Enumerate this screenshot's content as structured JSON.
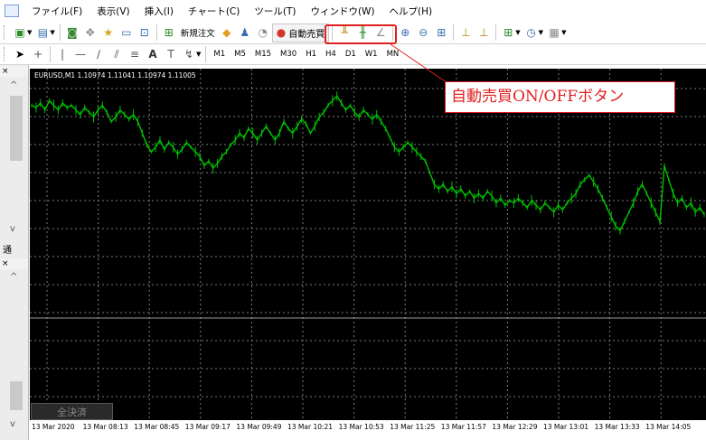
{
  "menu": [
    "ファイル(F)",
    "表示(V)",
    "挿入(I)",
    "チャート(C)",
    "ツール(T)",
    "ウィンドウ(W)",
    "ヘルプ(H)"
  ],
  "toolbar": {
    "new_order_label": "新規注文",
    "auto_trading_label": "自動売買"
  },
  "timeframes": [
    "M1",
    "M5",
    "M15",
    "M30",
    "H1",
    "H4",
    "D1",
    "W1",
    "MN"
  ],
  "left_panel": {
    "close_glyph": "×",
    "tab_label": "通"
  },
  "chart": {
    "title": "EURUSD,M1  1.10974 1.11041 1.10974 1.11005",
    "line_color": "#00c000",
    "background": "#000000",
    "grid_color": "#7a7a7a",
    "closed_tab_label": "全決済"
  },
  "chart_data": {
    "type": "line",
    "title": "EURUSD,M1  1.10974 1.11041 1.10974 1.11005",
    "xlabel": "",
    "ylabel": "",
    "x_ticks": [
      "13 Mar 2020",
      "13 Mar 08:13",
      "13 Mar 08:45",
      "13 Mar 09:17",
      "13 Mar 09:49",
      "13 Mar 10:21",
      "13 Mar 10:53",
      "13 Mar 11:25",
      "13 Mar 11:57",
      "13 Mar 12:29",
      "13 Mar 13:01",
      "13 Mar 13:33",
      "13 Mar 14:05"
    ],
    "grid": true,
    "series": [
      {
        "values": [
          0.62,
          0.61,
          0.63,
          0.6,
          0.64,
          0.62,
          0.6,
          0.63,
          0.61,
          0.62,
          0.6,
          0.58,
          0.61,
          0.59,
          0.57,
          0.6,
          0.62,
          0.59,
          0.55,
          0.57,
          0.6,
          0.58,
          0.56,
          0.58,
          0.55,
          0.5,
          0.45,
          0.42,
          0.44,
          0.47,
          0.43,
          0.46,
          0.44,
          0.41,
          0.43,
          0.46,
          0.44,
          0.42,
          0.4,
          0.36,
          0.38,
          0.35,
          0.37,
          0.4,
          0.42,
          0.45,
          0.47,
          0.5,
          0.48,
          0.52,
          0.5,
          0.47,
          0.5,
          0.53,
          0.5,
          0.47,
          0.5,
          0.55,
          0.52,
          0.5,
          0.53,
          0.56,
          0.54,
          0.5,
          0.53,
          0.57,
          0.59,
          0.62,
          0.64,
          0.66,
          0.63,
          0.6,
          0.62,
          0.59,
          0.57,
          0.6,
          0.58,
          0.56,
          0.58,
          0.55,
          0.52,
          0.48,
          0.44,
          0.42,
          0.44,
          0.46,
          0.44,
          0.42,
          0.4,
          0.38,
          0.33,
          0.28,
          0.26,
          0.28,
          0.25,
          0.27,
          0.24,
          0.26,
          0.23,
          0.25,
          0.22,
          0.24,
          0.22,
          0.25,
          0.23,
          0.2,
          0.22,
          0.19,
          0.21,
          0.2,
          0.22,
          0.2,
          0.18,
          0.21,
          0.19,
          0.17,
          0.2,
          0.18,
          0.16,
          0.19,
          0.17,
          0.2,
          0.22,
          0.24,
          0.28,
          0.3,
          0.32,
          0.29,
          0.26,
          0.22,
          0.18,
          0.14,
          0.1,
          0.08,
          0.12,
          0.16,
          0.2,
          0.25,
          0.28,
          0.24,
          0.2,
          0.16,
          0.12,
          0.36,
          0.3,
          0.24,
          0.2,
          0.22,
          0.18,
          0.2,
          0.16,
          0.18,
          0.15
        ]
      }
    ]
  },
  "annotation": {
    "label": "自動売買ON/OFFボタン",
    "color": "#e02020"
  }
}
